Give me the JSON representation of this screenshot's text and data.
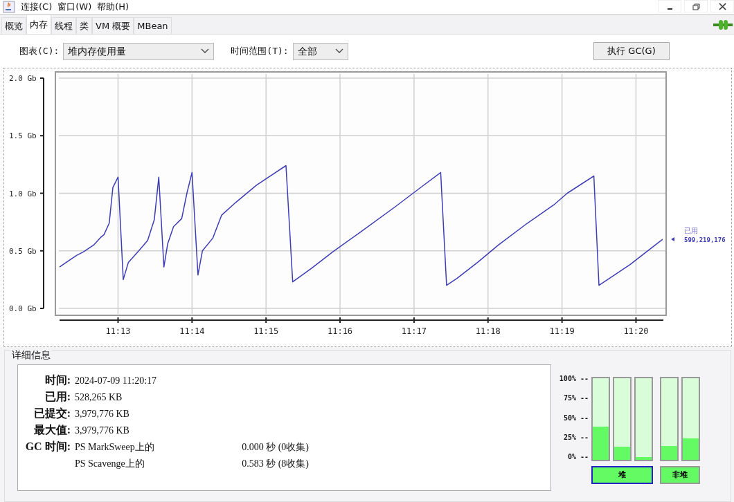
{
  "window": {
    "menu": [
      "连接(C)",
      "窗口(W)",
      "帮助(H)"
    ]
  },
  "tabs": [
    {
      "label": "概览",
      "selected": false
    },
    {
      "label": "内存",
      "selected": true
    },
    {
      "label": "线程",
      "selected": false
    },
    {
      "label": "类",
      "selected": false
    },
    {
      "label": "VM 概要",
      "selected": false
    },
    {
      "label": "MBean",
      "selected": false
    }
  ],
  "toolbar": {
    "chart_label": "图表(C):",
    "chart_value": "堆内存使用量",
    "range_label": "时间范围(T):",
    "range_value": "全部",
    "gc_button": "执行 GC(G)"
  },
  "chart": {
    "chart_data": {
      "type": "line",
      "x": [
        672.21,
        672.3,
        672.44,
        672.53,
        672.67,
        672.77,
        672.81,
        672.88,
        672.93,
        673.0,
        673.07,
        673.14,
        673.28,
        673.4,
        673.49,
        673.55,
        673.62,
        673.67,
        673.75,
        673.86,
        673.93,
        674.0,
        674.08,
        674.14,
        674.28,
        674.4,
        674.59,
        674.87,
        675.27,
        675.36,
        675.62,
        675.9,
        676.27,
        676.74,
        677.11,
        677.36,
        677.44,
        677.58,
        677.86,
        678.14,
        678.51,
        678.89,
        679.07,
        679.43,
        679.5,
        679.64,
        679.92,
        680.2,
        680.36
      ],
      "series": [
        {
          "name": "已用",
          "color": "#3c3cb4",
          "values": [
            0.36,
            0.4,
            0.46,
            0.49,
            0.55,
            0.62,
            0.64,
            0.74,
            1.05,
            1.14,
            0.25,
            0.4,
            0.5,
            0.59,
            0.77,
            1.14,
            0.36,
            0.56,
            0.71,
            0.78,
            1.0,
            1.18,
            0.29,
            0.5,
            0.61,
            0.81,
            0.92,
            1.07,
            1.24,
            0.23,
            0.35,
            0.49,
            0.66,
            0.88,
            1.06,
            1.18,
            0.2,
            0.26,
            0.4,
            0.55,
            0.73,
            0.9,
            1.0,
            1.15,
            0.2,
            0.26,
            0.38,
            0.52,
            0.6
          ]
        }
      ],
      "xlim": [
        672.2,
        680.37
      ],
      "ylim": [
        0,
        2
      ],
      "grid": true,
      "xticks": [
        {
          "value": 673,
          "label": "11:13"
        },
        {
          "value": 674,
          "label": "11:14"
        },
        {
          "value": 675,
          "label": "11:15"
        },
        {
          "value": 676,
          "label": "11:16"
        },
        {
          "value": 677,
          "label": "11:17"
        },
        {
          "value": 678,
          "label": "11:18"
        },
        {
          "value": 679,
          "label": "11:19"
        },
        {
          "value": 680,
          "label": "11:20"
        }
      ],
      "yticks": [
        {
          "value": 0,
          "label": "0.0 Gb"
        },
        {
          "value": 0.5,
          "label": "0.5 Gb"
        },
        {
          "value": 1,
          "label": "1.0 Gb"
        },
        {
          "value": 1.5,
          "label": "1.5 Gb"
        },
        {
          "value": 2,
          "label": "2.0 Gb"
        }
      ]
    },
    "legend": {
      "value": "599,219,176"
    }
  },
  "details": {
    "title": "详细信息",
    "rows": [
      {
        "label": "时间:",
        "value": "2024-07-09 11:20:17"
      },
      {
        "label": "已用:",
        "value": "528,265 KB"
      },
      {
        "label": "已提交:",
        "value": "3,979,776 KB"
      },
      {
        "label": "最大值:",
        "value": "3,979,776 KB"
      }
    ],
    "gc_label": "GC 时间:",
    "gc": [
      {
        "collector": "PS MarkSweep上的",
        "time": "0.000 秒 (0收集)"
      },
      {
        "collector": "PS Scavenge上的",
        "time": "0.583 秒 (8收集)"
      }
    ]
  },
  "usage": {
    "scale": [
      "100% --",
      "75% --",
      "50% --",
      "25% --",
      "0% --"
    ],
    "groups": [
      {
        "label": "堆",
        "selected": true,
        "bars": [
          {
            "level": 0.41
          },
          {
            "level": 0.16
          },
          {
            "level": 0.03
          }
        ]
      },
      {
        "label": "非堆",
        "selected": false,
        "bars": [
          {
            "level": 0.17
          },
          {
            "level": 0.26
          }
        ]
      }
    ]
  }
}
